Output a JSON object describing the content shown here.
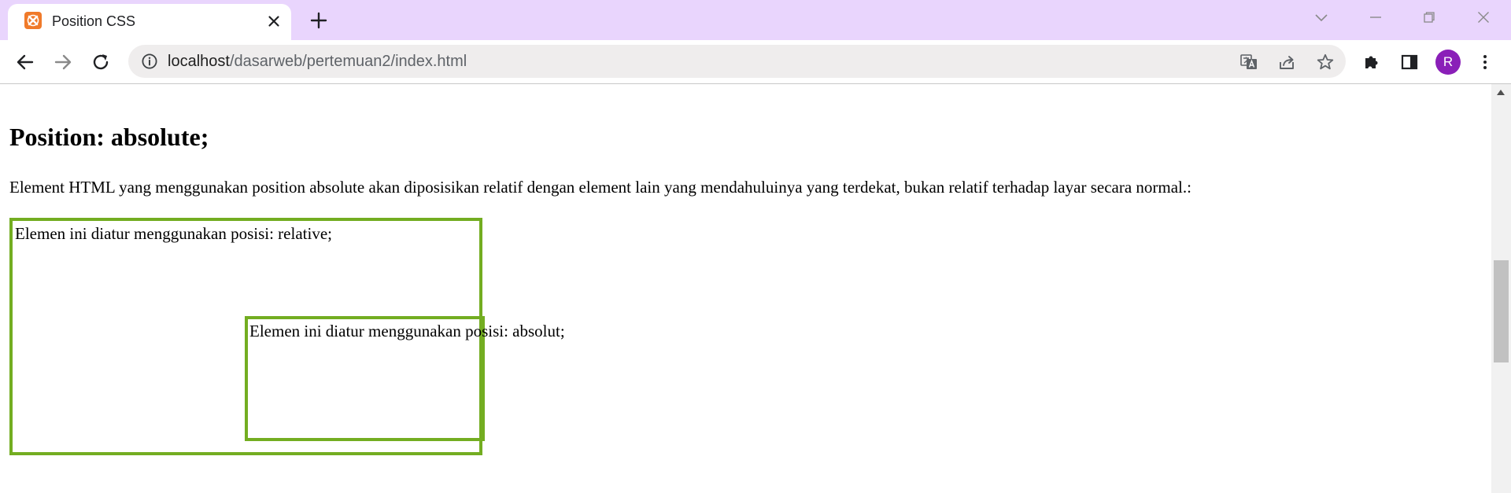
{
  "tab": {
    "title": "Position CSS"
  },
  "address_bar": {
    "url_host": "localhost",
    "url_path": "/dasarweb/pertemuan2/index.html"
  },
  "profile": {
    "initial": "R",
    "color": "#8a1fb8"
  },
  "colors": {
    "tabstrip": "#e9d5fd",
    "box_border": "#73ad21",
    "favicon": "#f07a2a"
  },
  "page": {
    "heading": "Position: absolute;",
    "description": "Element HTML yang menggunakan position absolute akan diposisikan relatif dengan element lain yang mendahuluinya yang terdekat, bukan relatif terhadap layar secara normal.:",
    "relative_box_text": "Elemen ini diatur menggunakan posisi: relative;",
    "absolute_box_text": "Elemen ini diatur menggunakan posisi: absolut;"
  },
  "icons": {
    "favicon": "xampp-icon",
    "close": "close-icon",
    "new_tab": "plus-icon",
    "back": "arrow-left-icon",
    "forward": "arrow-right-icon",
    "reload": "reload-icon",
    "info": "info-icon",
    "translate": "translate-icon",
    "share": "share-icon",
    "bookmark": "star-icon",
    "extensions": "puzzle-icon",
    "side_panel": "side-panel-icon",
    "menu": "kebab-menu-icon"
  }
}
